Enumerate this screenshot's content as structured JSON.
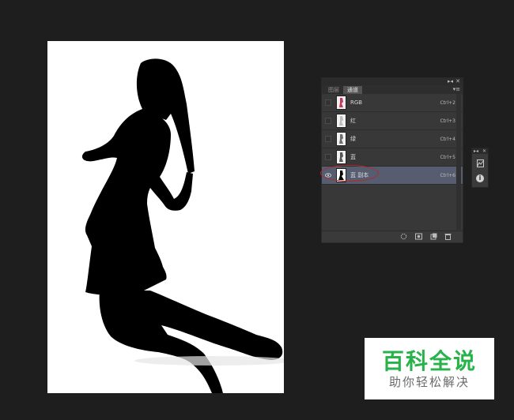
{
  "panel": {
    "topbar_collapse": "▸◂",
    "topbar_close": "✕",
    "tabs": [
      {
        "label": "图层",
        "active": false
      },
      {
        "label": "通道",
        "active": true
      }
    ],
    "menu_icon": "▾≡",
    "channels": [
      {
        "label": "RGB",
        "shortcut": "Ctrl+2",
        "visible": false,
        "selected": false
      },
      {
        "label": "红",
        "shortcut": "Ctrl+3",
        "visible": false,
        "selected": false
      },
      {
        "label": "绿",
        "shortcut": "Ctrl+4",
        "visible": false,
        "selected": false
      },
      {
        "label": "蓝",
        "shortcut": "Ctrl+5",
        "visible": false,
        "selected": false
      },
      {
        "label": "蓝 副本",
        "shortcut": "Ctrl+6",
        "visible": true,
        "selected": true
      }
    ],
    "bottom_buttons": [
      "load-selection-icon",
      "save-selection-icon",
      "new-channel-icon",
      "delete-channel-icon"
    ]
  },
  "mini_panel": {
    "collapse": "▸◂",
    "close": "✕",
    "icons": [
      "histogram-icon",
      "info-icon"
    ]
  },
  "watermark": {
    "title": "百科全说",
    "subtitle": "助你轻松解决",
    "title_color": "#27b24a"
  },
  "colors": {
    "workspace": "#1e1e1e",
    "panel": "#383838",
    "selected_row": "#565d70",
    "highlight_ellipse": "#b4282b"
  }
}
